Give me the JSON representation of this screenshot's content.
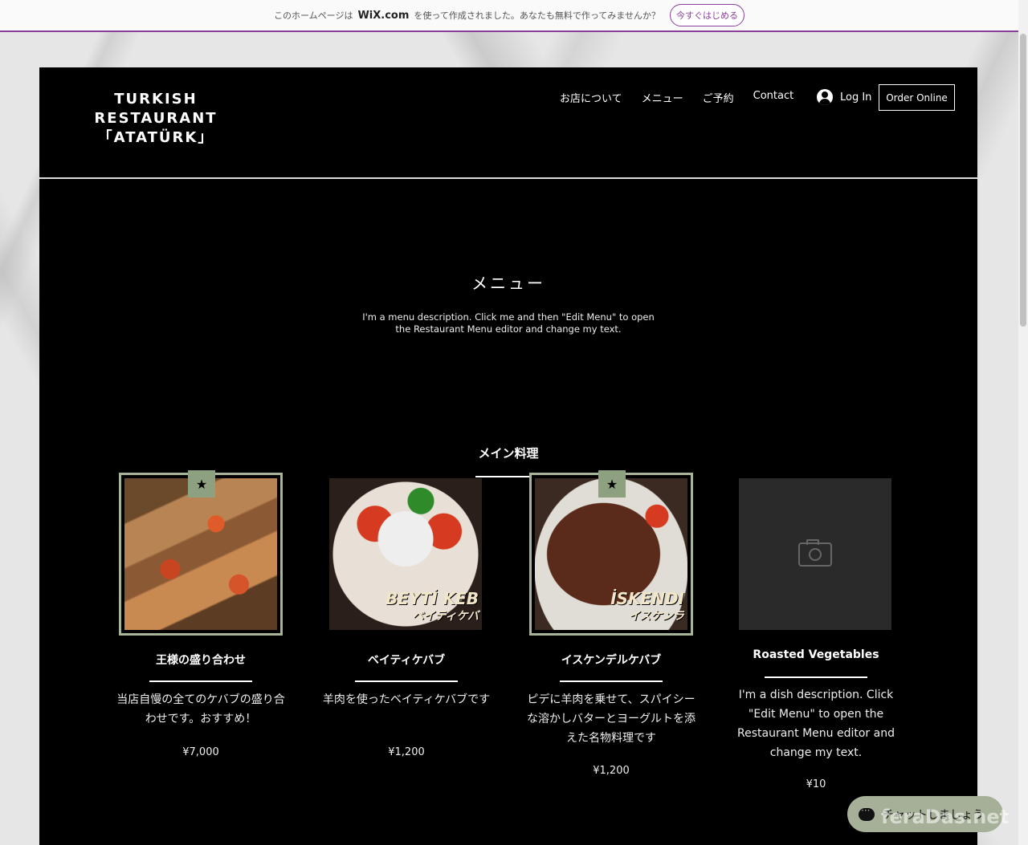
{
  "wix_banner": {
    "text_before": "このホームページは",
    "logo": "WiX.com",
    "text_after": "を使って作成されました。あなたも無料で作ってみませんか？",
    "cta": "今すぐはじめる"
  },
  "header": {
    "logo_lines": [
      "TURKISH",
      "RESTAURANT",
      "「ATATÜRK」"
    ],
    "nav": [
      "お店について",
      "メニュー",
      "ご予約",
      "Contact"
    ],
    "login": "Log In",
    "order_button": "Order Online"
  },
  "menu": {
    "title": "メニュー",
    "description": "I'm a menu description. Click me and then \"Edit Menu\" to open the Restaurant Menu editor and change my text.",
    "section": "メイン料理"
  },
  "dishes": [
    {
      "name": "王様の盛り合わせ",
      "desc": "当店自慢の全てのケバブの盛り合わせです。おすすめ！",
      "price": "¥7,000",
      "featured": true,
      "ribbon": "★",
      "icon": "star-icon"
    },
    {
      "name": "ベイティケバブ",
      "desc": "羊肉を使ったベイティケバブです",
      "price": "¥1,200",
      "featured": false,
      "photo_label": "BEYTİ KEB",
      "photo_label_jp": "ベイティケバ"
    },
    {
      "name": "イスケンデルケバブ",
      "desc": "ピデに羊肉を乗せて、スパイシーな溶かしバターとヨーグルトを添えた名物料理です",
      "price": "¥1,200",
      "featured": true,
      "ribbon": "★",
      "photo_label": "İSKENDI",
      "photo_label_jp": "イスケンラ"
    },
    {
      "name": "Roasted Vegetables",
      "desc": "I'm a dish description. Click \"Edit Menu\" to open the Restaurant Menu editor and change my text.",
      "price": "¥10",
      "featured": false,
      "icon": "camera-icon"
    }
  ],
  "chat": {
    "label": "チャットしましょう"
  },
  "watermark": "feraDas.net"
}
